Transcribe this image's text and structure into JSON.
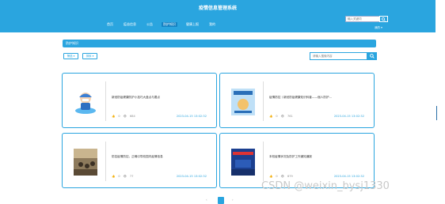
{
  "header": {
    "site_title": "疫情信息管理系统",
    "nav": [
      {
        "label": "首页"
      },
      {
        "label": "疫苗信息"
      },
      {
        "label": "公告"
      },
      {
        "label": "防护知识"
      },
      {
        "label": "健康上报"
      },
      {
        "label": "我的"
      }
    ],
    "search_placeholder": "输入关键词",
    "user_menu": "我的 ▾"
  },
  "breadcrumb": {
    "label": "防护知识"
  },
  "filters": {
    "left": [
      "筛选 ▾",
      "排序 ▾"
    ],
    "search_placeholder": "请输入搜索内容"
  },
  "articles": [
    {
      "title": "新冠防疫健康防护小技巧大盘点与要点",
      "likes": "0",
      "views": "684",
      "date": "2023-04-15 13:02:32"
    },
    {
      "title": "疫情防控丨新冠防疫健康知识科普——個人防护...",
      "likes": "0",
      "views": "761",
      "date": "2023-04-15 13:02:32"
    },
    {
      "title": "防控疫情防控，正确引导校园内疫情信息",
      "likes": "0",
      "views": "77",
      "date": "2023-04-15 13:02:32"
    },
    {
      "title": "本校疫情状况及防护工作通知通报",
      "likes": "0",
      "views": "679",
      "date": "2023-04-15 13:02:32"
    }
  ],
  "pagination": {
    "prev": "‹",
    "current": "1",
    "next": "›"
  },
  "watermark": "CSDN @weixin_bysj1330",
  "colors": {
    "primary": "#2aa5df",
    "active_nav": "#1483c4"
  }
}
